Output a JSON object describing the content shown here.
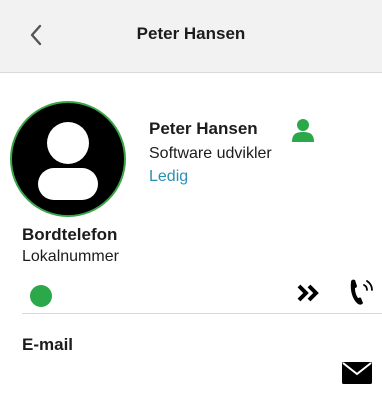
{
  "header": {
    "title": "Peter Hansen",
    "back_icon": "chevron-left-icon"
  },
  "profile": {
    "name": "Peter Hansen",
    "role": "Software udvikler",
    "status": "Ledig",
    "status_color": "#2a8fb5",
    "presence_icon": "person-icon",
    "presence_color": "#2aa84a",
    "avatar_ring_color": "#3aa548"
  },
  "desk_phone": {
    "title": "Bordtelefon",
    "subtitle": "Lokalnummer",
    "presence_color": "#2aa84a",
    "forward_icon": "double-chevron-right-icon",
    "call_icon": "phone-call-icon"
  },
  "email": {
    "title": "E-mail",
    "icon": "envelope-icon"
  }
}
